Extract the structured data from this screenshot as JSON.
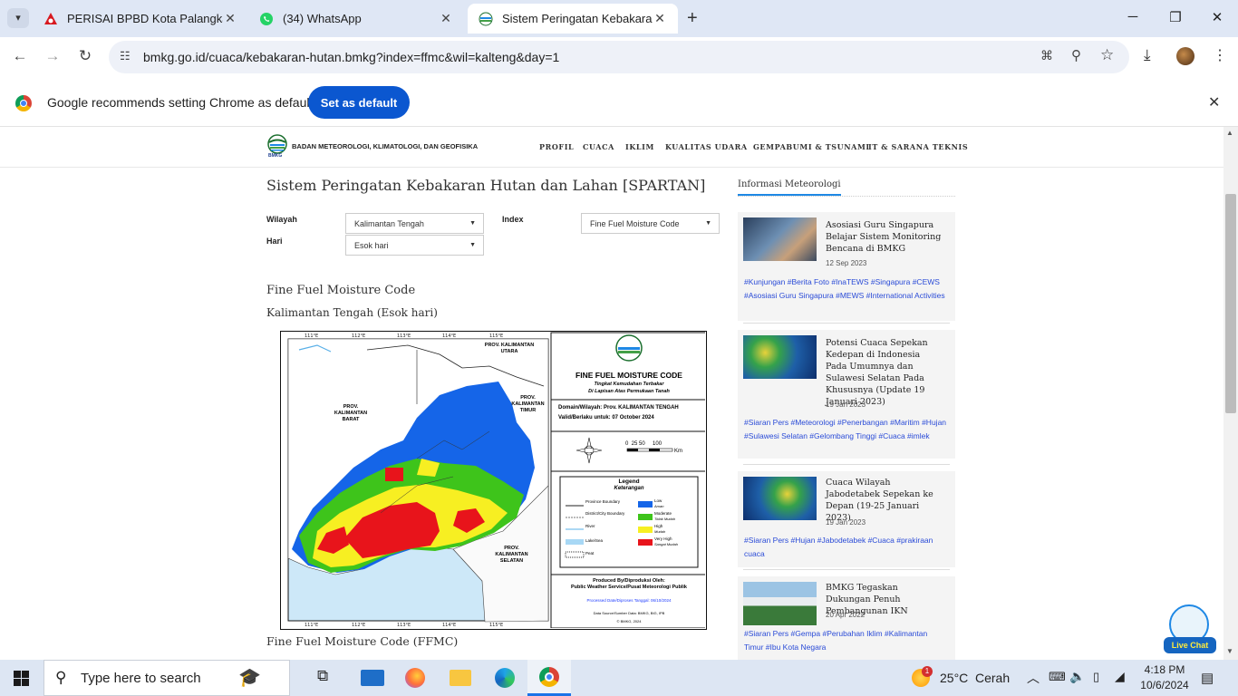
{
  "browser": {
    "tabs": [
      {
        "title": "PERISAI BPBD Kota Palangka Ra",
        "icon": "bpbd-favicon"
      },
      {
        "title": "(34) WhatsApp",
        "icon": "whatsapp-icon"
      },
      {
        "title": "Sistem Peringatan Kebakaran H",
        "icon": "bmkg-favicon",
        "active": true
      }
    ],
    "url": "bmkg.go.id/cuaca/kebakaran-hutan.bmkg?index=ffmc&wil=kalteng&day=1",
    "infobar_text": "Google recommends setting Chrome as default",
    "set_default_label": "Set as default"
  },
  "site": {
    "logo_text": "BADAN METEOROLOGI, KLIMATOLOGI, DAN GEOFISIKA",
    "logo_abbr": "BMKG",
    "nav": [
      "PROFIL",
      "CUACA",
      "IKLIM",
      "KUALITAS UDARA",
      "GEMPABUMI & TSUNAMI",
      "IT & SARANA TEKNIS"
    ]
  },
  "main": {
    "title": "Sistem Peringatan Kebakaran Hutan dan Lahan [SPARTAN]",
    "form": {
      "wilayah_label": "Wilayah",
      "wilayah_value": "Kalimantan Tengah",
      "index_label": "Index",
      "index_value": "Fine Fuel Moisture Code",
      "hari_label": "Hari",
      "hari_value": "Esok hari"
    },
    "section_title": "Fine Fuel Moisture Code",
    "section_subtitle": "Kalimantan Tengah (Esok hari)",
    "bottom_heading": "Fine Fuel Moisture Code (FFMC)"
  },
  "map": {
    "title": "FINE FUEL MOISTURE CODE",
    "subtitle1": "Tingkat Kemudahan Terbakar",
    "subtitle2": "Di Lapisan Atas Permukaan Tanah",
    "domain": "Domain/Wilayah: Prov. KALIMANTAN TENGAH",
    "valid": "Valid/Berlaku untuk: 07 October 2024",
    "scale_text": "0  25 50     100",
    "scale_unit": "Km",
    "legend_title": "Legend",
    "legend_subtitle": "Keterangan",
    "legend_lines": [
      "Province Boundary",
      "District/City Boundary",
      "River",
      "Lake/Sea",
      "Peat"
    ],
    "legend_classes": [
      "Low",
      "Moderate",
      "High",
      "Very High"
    ],
    "legend_class_notes": [
      "Aman",
      "Tidak Mudah",
      "Mudah",
      "Sangat Mudah"
    ],
    "class_colors": [
      "#1565e8",
      "#3ec41b",
      "#f7ef22",
      "#e8141b"
    ],
    "produced_by": "Produced By/Diproduksi Oleh:",
    "produced_org": "Public Weather Service/Pusat Meteorologi Publik",
    "processed": "Processed Date/Diproses Tanggal: 06/10/2024",
    "source": "Data Source/Sumber Data: BMKG, BIG, IPB",
    "copyright": "© BMKG, 2024",
    "place_labels": [
      "PROV. KALIMANTAN UTARA",
      "PROV. KALIMANTAN TIMUR",
      "PROV. KALIMANTAN BARAT",
      "PROV. KALIMANTAN SELATAN"
    ],
    "lon_ticks": [
      "111°E",
      "112°E",
      "113°E",
      "114°E",
      "115°E"
    ],
    "lat_ticks": [
      "1°S",
      "0°",
      "1°S",
      "2°S",
      "3°S",
      "4°S"
    ]
  },
  "sidebar": {
    "heading": "Informasi Meteorologi",
    "items": [
      {
        "title": "Asosiasi Guru Singapura Belajar Sistem Monitoring Bencana di BMKG",
        "date": "12 Sep 2023",
        "tags": "#Kunjungan #Berita Foto #InaTEWS #Singapura #CEWS #Asosiasi Guru Singapura #MEWS #International Activities"
      },
      {
        "title": "Potensi Cuaca Sepekan Kedepan di Indonesia Pada Umumnya dan Sulawesi Selatan Pada Khususnya (Update 19 Januari 2023)",
        "date": "19 Jan 2023",
        "tags": "#Siaran Pers #Meteorologi #Penerbangan #Maritim #Hujan #Sulawesi Selatan #Gelombang Tinggi #Cuaca #imlek"
      },
      {
        "title": "Cuaca Wilayah Jabodetabek Sepekan ke Depan (19-25 Januari 2023)",
        "date": "19 Jan 2023",
        "tags": "#Siaran Pers #Hujan #Jabodetabek #Cuaca #prakiraan cuaca"
      },
      {
        "title": "BMKG Tegaskan Dukungan Penuh Pembangunan IKN",
        "date": "20 Apr 2022",
        "tags": "#Siaran Pers #Gempa #Perubahan Iklim #Kalimantan Timur #Ibu Kota Negara"
      }
    ]
  },
  "live_chat": "Live Chat",
  "taskbar": {
    "search_placeholder": "Type here to search",
    "temperature": "25°C",
    "weather": "Cerah",
    "weather_badge": "1",
    "time": "4:18 PM",
    "date": "10/6/2024"
  }
}
